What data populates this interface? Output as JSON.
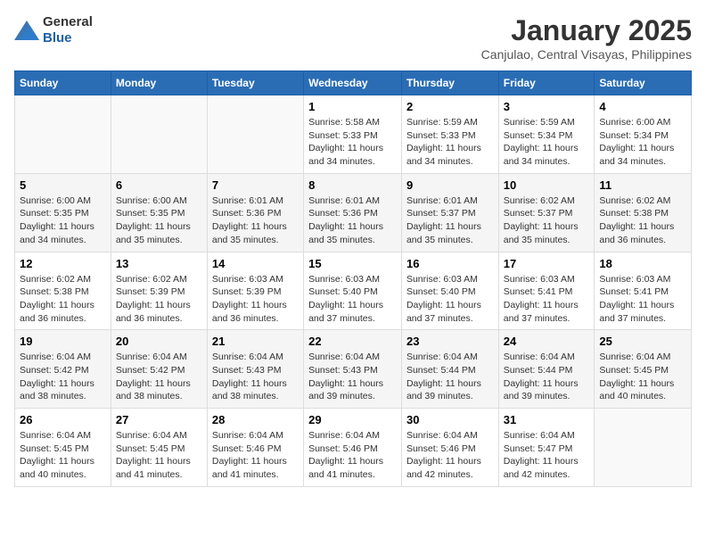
{
  "logo": {
    "general": "General",
    "blue": "Blue"
  },
  "header": {
    "month": "January 2025",
    "location": "Canjulao, Central Visayas, Philippines"
  },
  "weekdays": [
    "Sunday",
    "Monday",
    "Tuesday",
    "Wednesday",
    "Thursday",
    "Friday",
    "Saturday"
  ],
  "weeks": [
    [
      {
        "day": "",
        "sunrise": "",
        "sunset": "",
        "daylight": ""
      },
      {
        "day": "",
        "sunrise": "",
        "sunset": "",
        "daylight": ""
      },
      {
        "day": "",
        "sunrise": "",
        "sunset": "",
        "daylight": ""
      },
      {
        "day": "1",
        "sunrise": "Sunrise: 5:58 AM",
        "sunset": "Sunset: 5:33 PM",
        "daylight": "Daylight: 11 hours and 34 minutes."
      },
      {
        "day": "2",
        "sunrise": "Sunrise: 5:59 AM",
        "sunset": "Sunset: 5:33 PM",
        "daylight": "Daylight: 11 hours and 34 minutes."
      },
      {
        "day": "3",
        "sunrise": "Sunrise: 5:59 AM",
        "sunset": "Sunset: 5:34 PM",
        "daylight": "Daylight: 11 hours and 34 minutes."
      },
      {
        "day": "4",
        "sunrise": "Sunrise: 6:00 AM",
        "sunset": "Sunset: 5:34 PM",
        "daylight": "Daylight: 11 hours and 34 minutes."
      }
    ],
    [
      {
        "day": "5",
        "sunrise": "Sunrise: 6:00 AM",
        "sunset": "Sunset: 5:35 PM",
        "daylight": "Daylight: 11 hours and 34 minutes."
      },
      {
        "day": "6",
        "sunrise": "Sunrise: 6:00 AM",
        "sunset": "Sunset: 5:35 PM",
        "daylight": "Daylight: 11 hours and 35 minutes."
      },
      {
        "day": "7",
        "sunrise": "Sunrise: 6:01 AM",
        "sunset": "Sunset: 5:36 PM",
        "daylight": "Daylight: 11 hours and 35 minutes."
      },
      {
        "day": "8",
        "sunrise": "Sunrise: 6:01 AM",
        "sunset": "Sunset: 5:36 PM",
        "daylight": "Daylight: 11 hours and 35 minutes."
      },
      {
        "day": "9",
        "sunrise": "Sunrise: 6:01 AM",
        "sunset": "Sunset: 5:37 PM",
        "daylight": "Daylight: 11 hours and 35 minutes."
      },
      {
        "day": "10",
        "sunrise": "Sunrise: 6:02 AM",
        "sunset": "Sunset: 5:37 PM",
        "daylight": "Daylight: 11 hours and 35 minutes."
      },
      {
        "day": "11",
        "sunrise": "Sunrise: 6:02 AM",
        "sunset": "Sunset: 5:38 PM",
        "daylight": "Daylight: 11 hours and 36 minutes."
      }
    ],
    [
      {
        "day": "12",
        "sunrise": "Sunrise: 6:02 AM",
        "sunset": "Sunset: 5:38 PM",
        "daylight": "Daylight: 11 hours and 36 minutes."
      },
      {
        "day": "13",
        "sunrise": "Sunrise: 6:02 AM",
        "sunset": "Sunset: 5:39 PM",
        "daylight": "Daylight: 11 hours and 36 minutes."
      },
      {
        "day": "14",
        "sunrise": "Sunrise: 6:03 AM",
        "sunset": "Sunset: 5:39 PM",
        "daylight": "Daylight: 11 hours and 36 minutes."
      },
      {
        "day": "15",
        "sunrise": "Sunrise: 6:03 AM",
        "sunset": "Sunset: 5:40 PM",
        "daylight": "Daylight: 11 hours and 37 minutes."
      },
      {
        "day": "16",
        "sunrise": "Sunrise: 6:03 AM",
        "sunset": "Sunset: 5:40 PM",
        "daylight": "Daylight: 11 hours and 37 minutes."
      },
      {
        "day": "17",
        "sunrise": "Sunrise: 6:03 AM",
        "sunset": "Sunset: 5:41 PM",
        "daylight": "Daylight: 11 hours and 37 minutes."
      },
      {
        "day": "18",
        "sunrise": "Sunrise: 6:03 AM",
        "sunset": "Sunset: 5:41 PM",
        "daylight": "Daylight: 11 hours and 37 minutes."
      }
    ],
    [
      {
        "day": "19",
        "sunrise": "Sunrise: 6:04 AM",
        "sunset": "Sunset: 5:42 PM",
        "daylight": "Daylight: 11 hours and 38 minutes."
      },
      {
        "day": "20",
        "sunrise": "Sunrise: 6:04 AM",
        "sunset": "Sunset: 5:42 PM",
        "daylight": "Daylight: 11 hours and 38 minutes."
      },
      {
        "day": "21",
        "sunrise": "Sunrise: 6:04 AM",
        "sunset": "Sunset: 5:43 PM",
        "daylight": "Daylight: 11 hours and 38 minutes."
      },
      {
        "day": "22",
        "sunrise": "Sunrise: 6:04 AM",
        "sunset": "Sunset: 5:43 PM",
        "daylight": "Daylight: 11 hours and 39 minutes."
      },
      {
        "day": "23",
        "sunrise": "Sunrise: 6:04 AM",
        "sunset": "Sunset: 5:44 PM",
        "daylight": "Daylight: 11 hours and 39 minutes."
      },
      {
        "day": "24",
        "sunrise": "Sunrise: 6:04 AM",
        "sunset": "Sunset: 5:44 PM",
        "daylight": "Daylight: 11 hours and 39 minutes."
      },
      {
        "day": "25",
        "sunrise": "Sunrise: 6:04 AM",
        "sunset": "Sunset: 5:45 PM",
        "daylight": "Daylight: 11 hours and 40 minutes."
      }
    ],
    [
      {
        "day": "26",
        "sunrise": "Sunrise: 6:04 AM",
        "sunset": "Sunset: 5:45 PM",
        "daylight": "Daylight: 11 hours and 40 minutes."
      },
      {
        "day": "27",
        "sunrise": "Sunrise: 6:04 AM",
        "sunset": "Sunset: 5:45 PM",
        "daylight": "Daylight: 11 hours and 41 minutes."
      },
      {
        "day": "28",
        "sunrise": "Sunrise: 6:04 AM",
        "sunset": "Sunset: 5:46 PM",
        "daylight": "Daylight: 11 hours and 41 minutes."
      },
      {
        "day": "29",
        "sunrise": "Sunrise: 6:04 AM",
        "sunset": "Sunset: 5:46 PM",
        "daylight": "Daylight: 11 hours and 41 minutes."
      },
      {
        "day": "30",
        "sunrise": "Sunrise: 6:04 AM",
        "sunset": "Sunset: 5:46 PM",
        "daylight": "Daylight: 11 hours and 42 minutes."
      },
      {
        "day": "31",
        "sunrise": "Sunrise: 6:04 AM",
        "sunset": "Sunset: 5:47 PM",
        "daylight": "Daylight: 11 hours and 42 minutes."
      },
      {
        "day": "",
        "sunrise": "",
        "sunset": "",
        "daylight": ""
      }
    ]
  ]
}
